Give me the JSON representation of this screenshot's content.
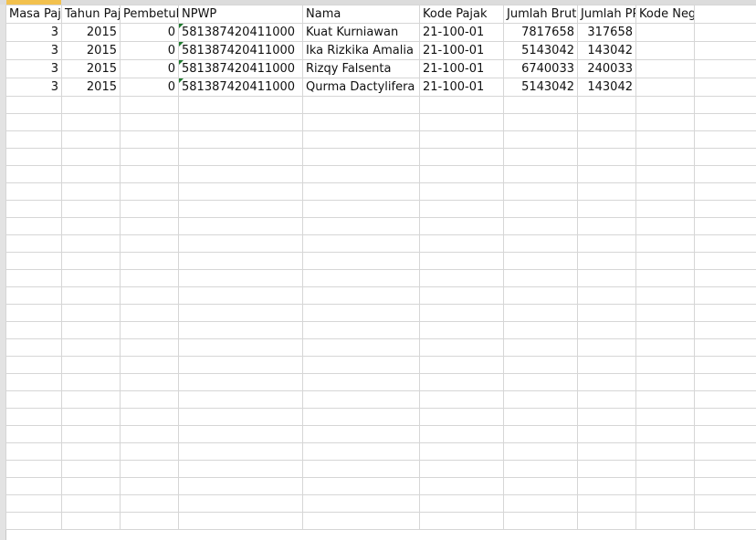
{
  "headers": [
    "Masa Paja",
    "Tahun Paj",
    "Pembetul",
    "NPWP",
    "Nama",
    "Kode Pajak",
    "Jumlah Bruto",
    "Jumlah PP",
    "Kode Negara",
    ""
  ],
  "rows": [
    [
      "3",
      "2015",
      "0",
      "581387420411000",
      "Kuat Kurniawan",
      "21-100-01",
      "7817658",
      "317658",
      "",
      ""
    ],
    [
      "3",
      "2015",
      "0",
      "581387420411000",
      "Ika Rizkika Amalia",
      "21-100-01",
      "5143042",
      "143042",
      "",
      ""
    ],
    [
      "3",
      "2015",
      "0",
      "581387420411000",
      "Rizqy Falsenta",
      "21-100-01",
      "6740033",
      "240033",
      "",
      ""
    ],
    [
      "3",
      "2015",
      "0",
      "581387420411000",
      "Qurma Dactylifera",
      "21-100-01",
      "5143042",
      "143042",
      "",
      ""
    ]
  ],
  "accent_color": "#f2c14e",
  "error_flag_color": "#1e7a2e"
}
